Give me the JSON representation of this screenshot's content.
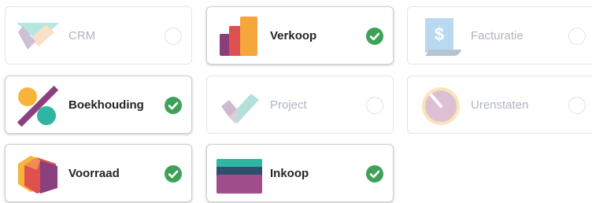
{
  "apps": [
    {
      "id": "crm",
      "label": "CRM",
      "selected": false,
      "icon": "crm-icon"
    },
    {
      "id": "verkoop",
      "label": "Verkoop",
      "selected": true,
      "icon": "sales-icon"
    },
    {
      "id": "facturatie",
      "label": "Facturatie",
      "selected": false,
      "icon": "invoicing-icon"
    },
    {
      "id": "boekhouding",
      "label": "Boekhouding",
      "selected": true,
      "icon": "accounting-icon"
    },
    {
      "id": "project",
      "label": "Project",
      "selected": false,
      "icon": "project-icon"
    },
    {
      "id": "urenstaten",
      "label": "Urenstaten",
      "selected": false,
      "icon": "timesheets-icon"
    },
    {
      "id": "voorraad",
      "label": "Voorraad",
      "selected": true,
      "icon": "inventory-icon"
    },
    {
      "id": "inkoop",
      "label": "Inkoop",
      "selected": true,
      "icon": "purchase-icon"
    }
  ],
  "colors": {
    "check_green": "#3fa159",
    "label_active": "#212529",
    "label_inactive": "#adb5bd"
  }
}
